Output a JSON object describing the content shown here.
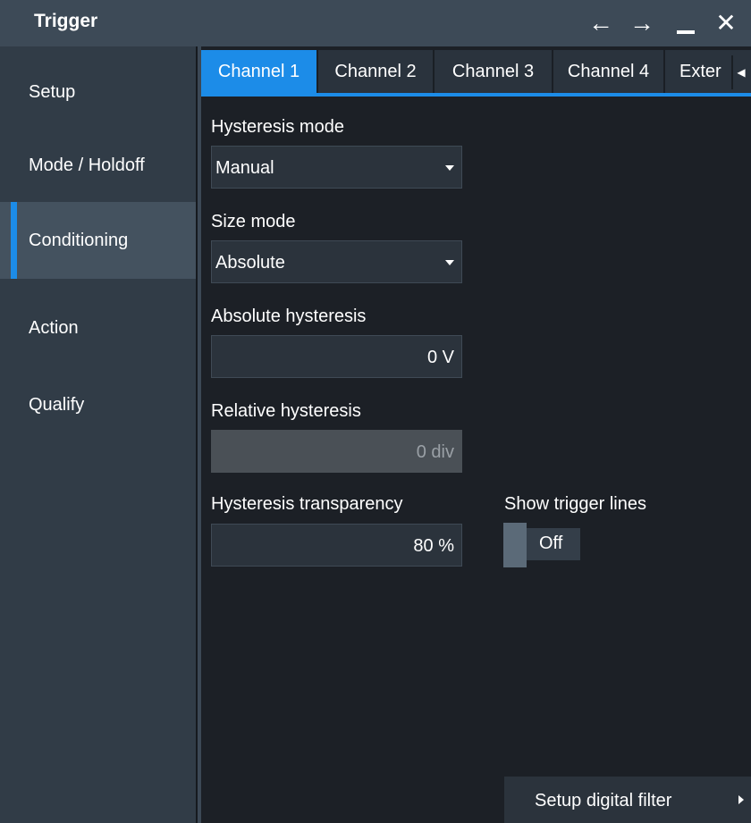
{
  "window": {
    "title": "Trigger",
    "buttons": {
      "back": "←",
      "forward": "→",
      "close": "✕"
    }
  },
  "sidebar": {
    "items": [
      {
        "label": "Setup",
        "active": false
      },
      {
        "label": "Mode / Holdoff",
        "active": false
      },
      {
        "label": "Conditioning",
        "active": true
      },
      {
        "label": "Action",
        "active": false
      },
      {
        "label": "Qualify",
        "active": false
      }
    ]
  },
  "tabs": [
    {
      "label": "Channel 1",
      "active": true
    },
    {
      "label": "Channel 2",
      "active": false
    },
    {
      "label": "Channel 3",
      "active": false
    },
    {
      "label": "Channel 4",
      "active": false
    },
    {
      "label": "Exter",
      "active": false
    }
  ],
  "form": {
    "hysteresis_mode": {
      "label": "Hysteresis mode",
      "value": "Manual"
    },
    "size_mode": {
      "label": "Size mode",
      "value": "Absolute"
    },
    "absolute_hysteresis": {
      "label": "Absolute hysteresis",
      "value": "0 V"
    },
    "relative_hysteresis": {
      "label": "Relative hysteresis",
      "value": "0 div",
      "disabled": true
    },
    "hysteresis_transparency": {
      "label": "Hysteresis transparency",
      "value": "80 %"
    },
    "show_trigger_lines": {
      "label": "Show trigger lines",
      "value": "Off"
    }
  },
  "footer": {
    "setup_digital_filter": "Setup digital filter"
  },
  "colors": {
    "accent": "#1c8ce8",
    "titlebar": "#3d4a57",
    "sidebar": "#313c47",
    "background": "#1c2026"
  }
}
